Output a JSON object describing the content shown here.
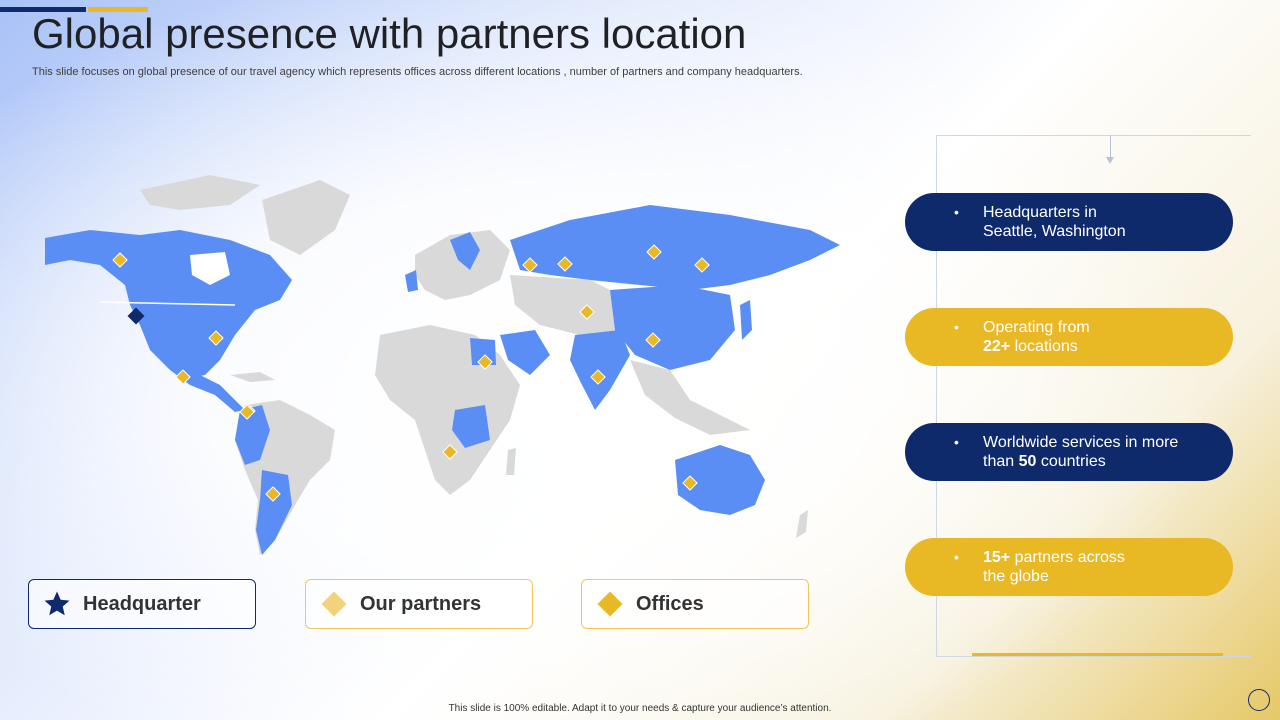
{
  "header": {
    "title": "Global presence with partners location",
    "subtitle": "This slide focuses on global presence of our travel  agency which represents offices across different locations , number of partners and company headquarters."
  },
  "cards": [
    {
      "lead": "",
      "text": "Headquarters in Seattle, Washington",
      "bold": "",
      "tail": "",
      "style": "navy"
    },
    {
      "lead": "Operating from ",
      "bold": "22+",
      "tail": " locations",
      "style": "gold"
    },
    {
      "lead": "Worldwide services in more than ",
      "bold": "50",
      "tail": " countries",
      "style": "navy"
    },
    {
      "lead": "",
      "bold": "15+",
      "tail": " partners across the globe",
      "style": "gold"
    }
  ],
  "card_texts": {
    "c1_line1": "Headquarters in",
    "c1_line2": "Seattle, Washington",
    "c2_a": "Operating from",
    "c2_bold": "22+",
    "c2_b": " locations",
    "c3_a": "Worldwide services in more",
    "c3_b": "than ",
    "c3_bold": "50",
    "c3_c": " countries",
    "c4_bold": "15+",
    "c4_a": " partners across",
    "c4_b": "the globe",
    "bullet": "•"
  },
  "legend": {
    "headquarter": "Headquarter",
    "partners": "Our partners",
    "offices": "Offices"
  },
  "footer": "This slide is 100% editable.  Adapt it to your needs & capture your audience’s attention.",
  "colors": {
    "navy": "#0f2a6b",
    "gold": "#e9b825",
    "light_gold": "#f2d27a",
    "map_highlight": "#5b8ef5",
    "map_base": "#d9d9d9"
  },
  "icons": {
    "headquarter": "star-icon",
    "partners": "diamond-icon",
    "offices": "diamond-icon"
  }
}
